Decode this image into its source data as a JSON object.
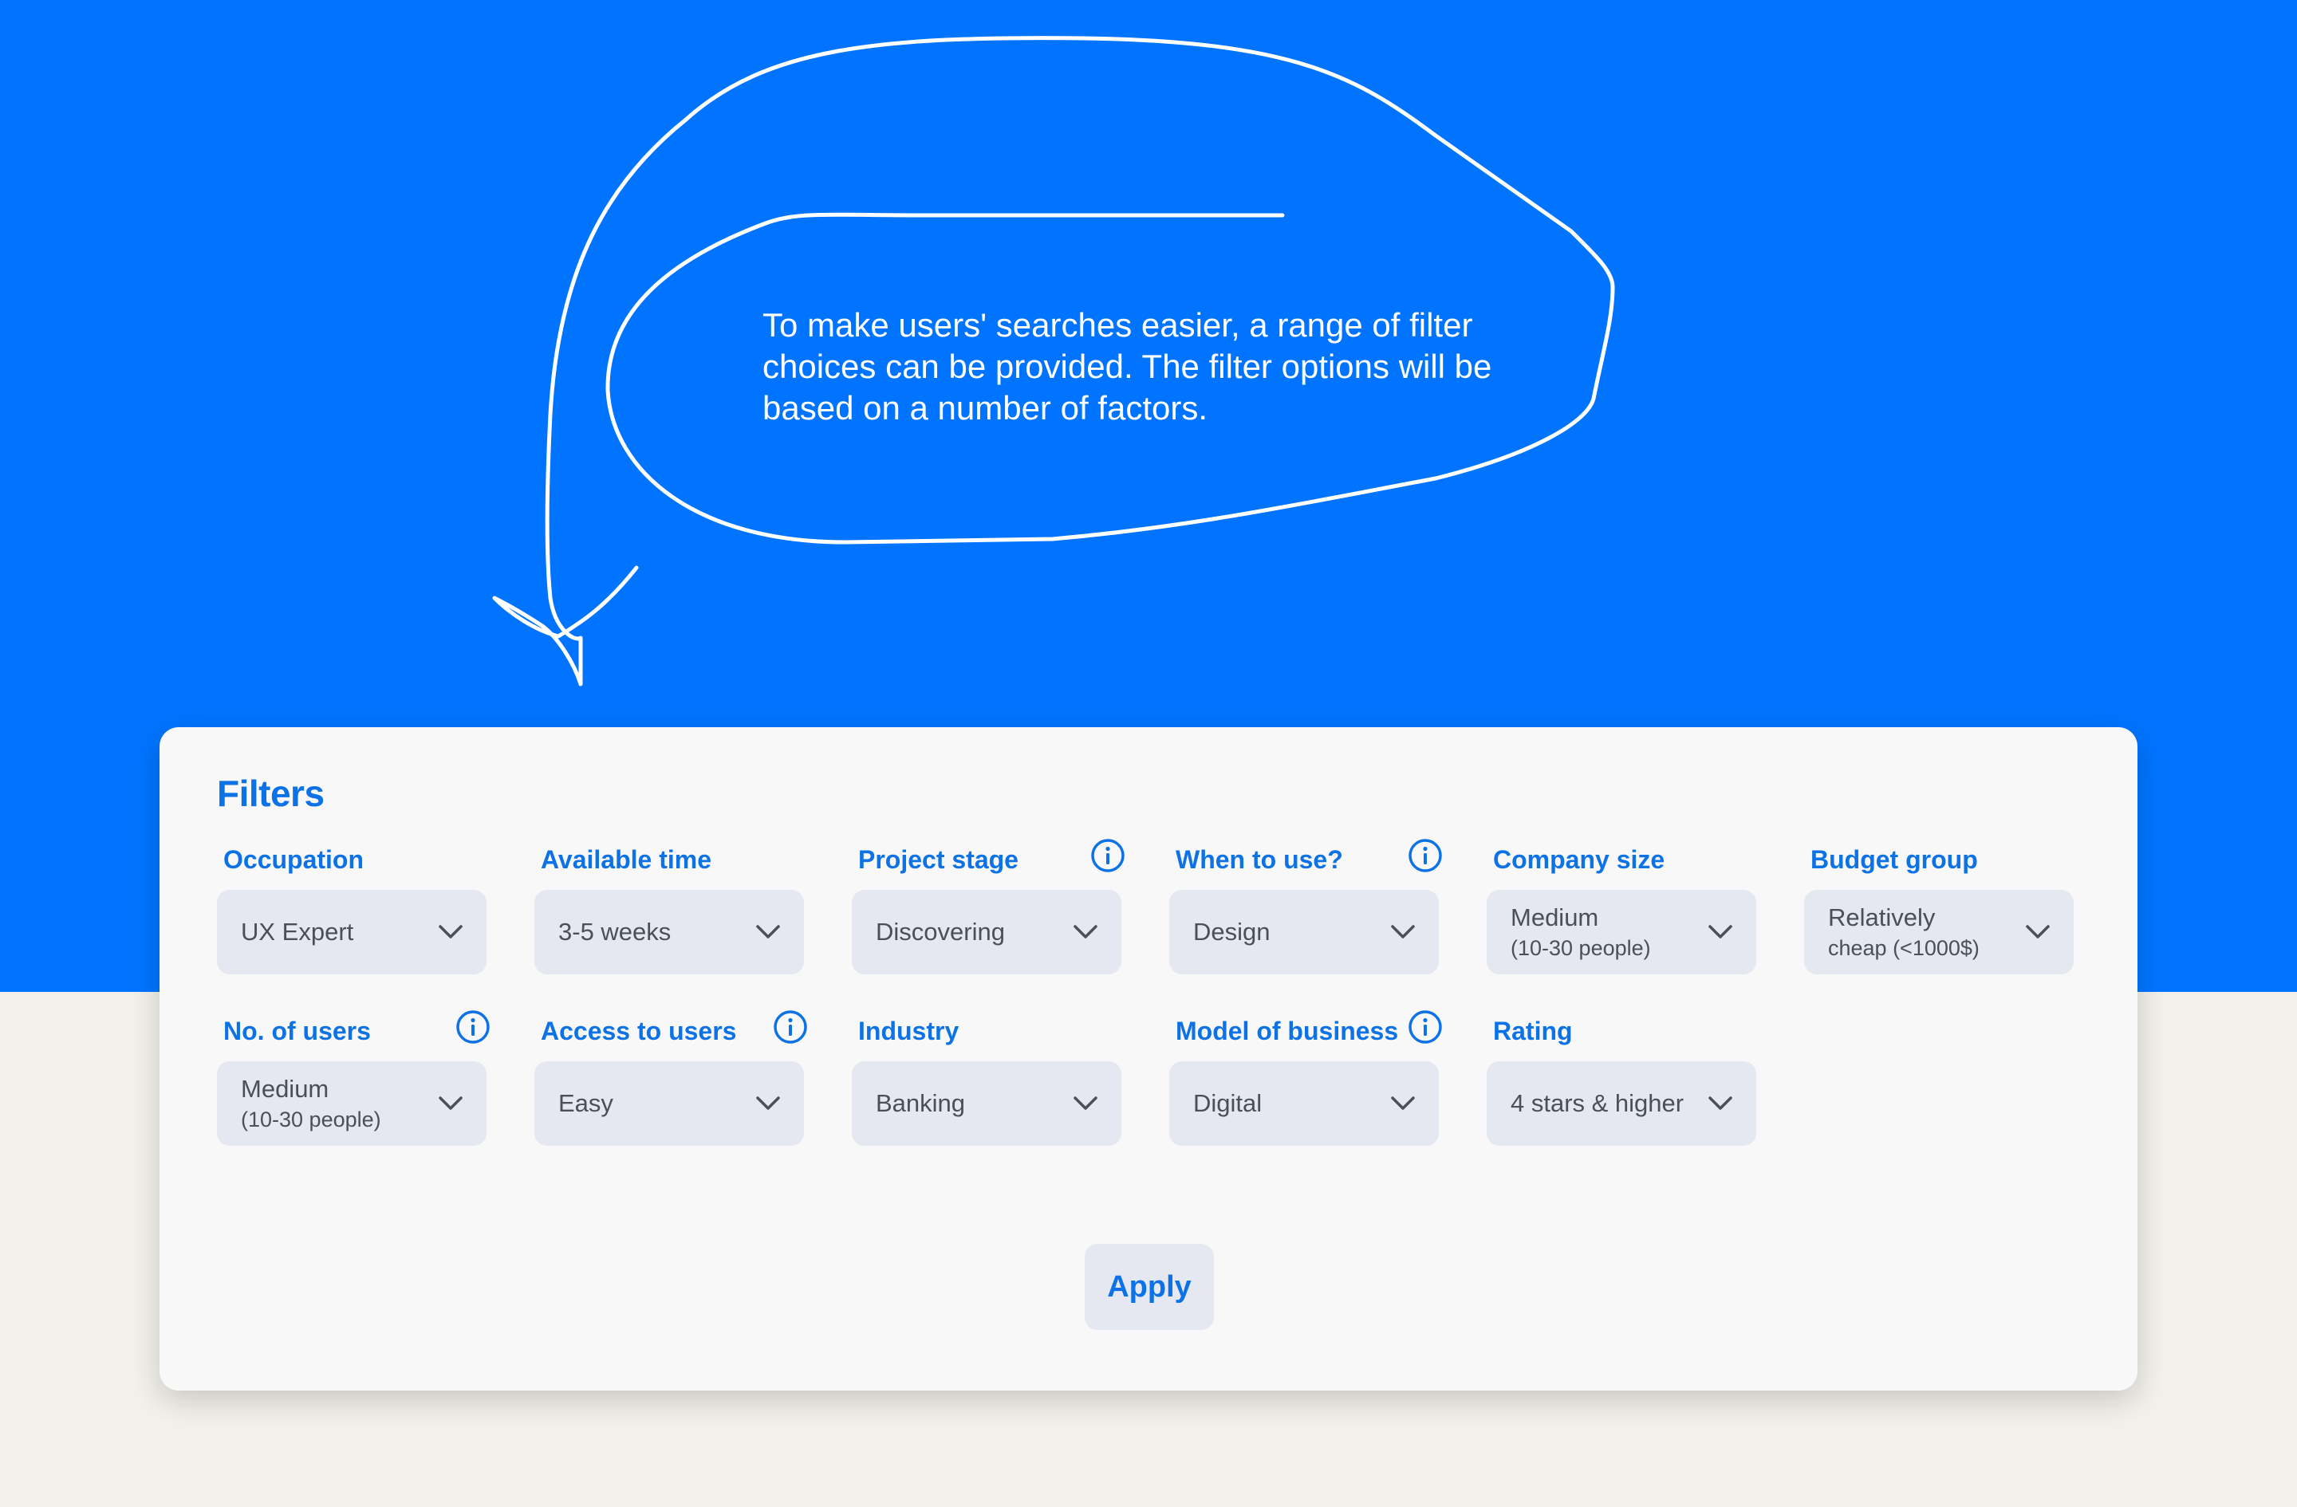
{
  "callout": {
    "text": "To make users' searches easier, a range of filter choices can be provided. The filter options will be based on a number of factors."
  },
  "filters": {
    "title": "Filters",
    "apply_label": "Apply",
    "fields": [
      {
        "label": "Occupation",
        "value": "UX Expert",
        "sub": "",
        "info": false
      },
      {
        "label": "Available time",
        "value": "3-5 weeks",
        "sub": "",
        "info": false
      },
      {
        "label": "Project stage",
        "value": "Discovering",
        "sub": "",
        "info": true
      },
      {
        "label": "When to use?",
        "value": "Design",
        "sub": "",
        "info": true
      },
      {
        "label": "Company size",
        "value": "Medium",
        "sub": "(10-30 people)",
        "info": false
      },
      {
        "label": "Budget group",
        "value": "Relatively",
        "sub": "cheap (<1000$)",
        "info": false
      },
      {
        "label": "No. of users",
        "value": "Medium",
        "sub": "(10-30 people)",
        "info": true
      },
      {
        "label": "Access to users",
        "value": "Easy",
        "sub": "",
        "info": true
      },
      {
        "label": "Industry",
        "value": "Banking",
        "sub": "",
        "info": false
      },
      {
        "label": "Model of business",
        "value": "Digital",
        "sub": "",
        "info": true
      },
      {
        "label": "Rating",
        "value": "4 stars & higher",
        "sub": "",
        "info": false
      }
    ]
  },
  "icons": {
    "info": "info-circle-icon",
    "dropdown": "chevron-down-icon"
  },
  "colors": {
    "accent": "#0d72e6",
    "background_top": "#0074ff",
    "background_bottom": "#f3f1eb",
    "select_bg": "#e5e8f1"
  }
}
